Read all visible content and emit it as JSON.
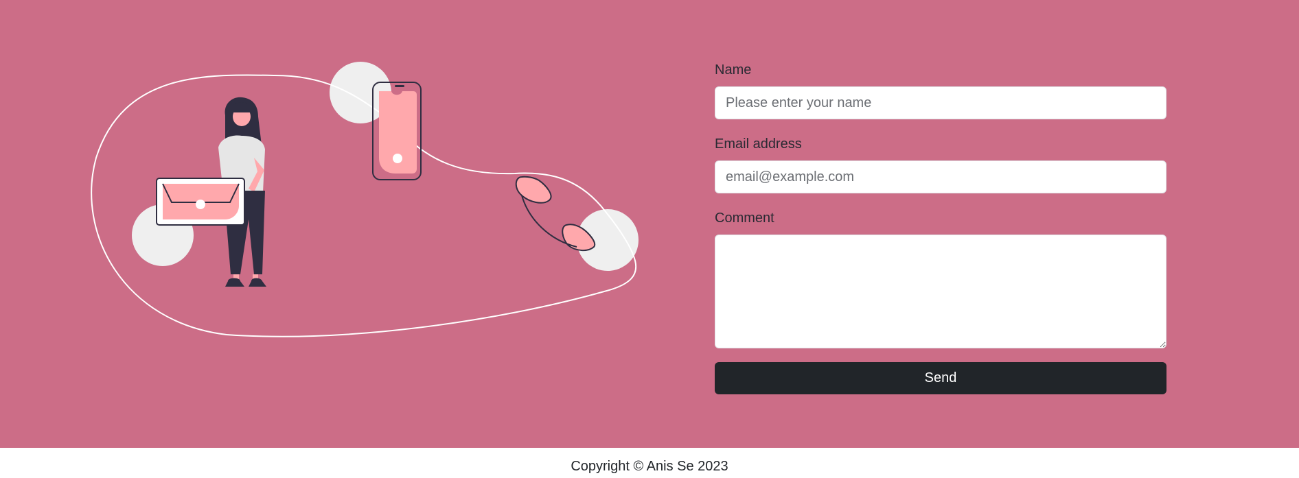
{
  "form": {
    "name_label": "Name",
    "name_placeholder": "Please enter your name",
    "name_value": "",
    "email_label": "Email address",
    "email_placeholder": "email@example.com",
    "email_value": "",
    "comment_label": "Comment",
    "comment_value": "",
    "send_label": "Send"
  },
  "footer": {
    "copyright": "Copyright © Anis Se 2023"
  },
  "colors": {
    "background": "#cc6d87",
    "button": "#212529",
    "accent_pink": "#ffa8ac",
    "dark_figure": "#2f2e41",
    "circle": "#efefef"
  },
  "illustration": {
    "name": "woman-with-laptop-and-phone-illustration"
  }
}
